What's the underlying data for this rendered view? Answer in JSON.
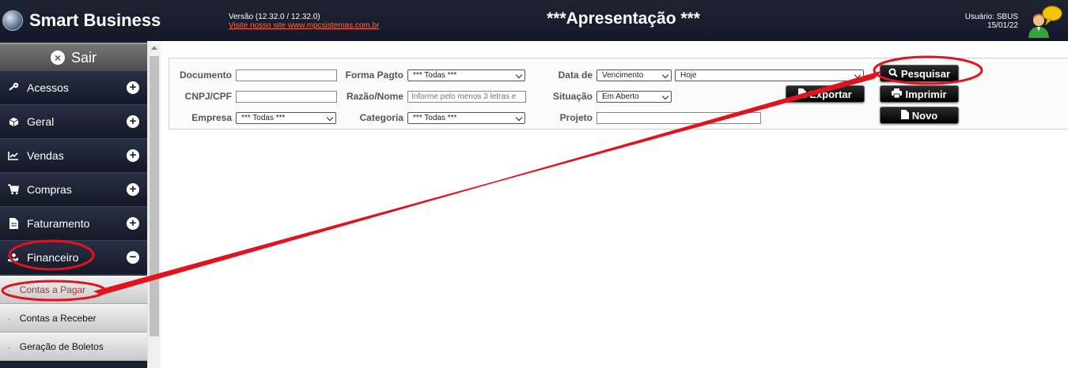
{
  "header": {
    "app_title": "Smart Business",
    "version": "Versão (12.32.0 / 12.32.0)",
    "site_link": "Visite nosso site www.mpcsistemas.com.br",
    "page_title": "***Apresentação ***",
    "user": "Usuário: SBUS",
    "date": "15/01/22"
  },
  "sidebar": {
    "sair": "Sair",
    "items": [
      {
        "label": "Acessos",
        "icon": "key-icon"
      },
      {
        "label": "Geral",
        "icon": "cube-icon"
      },
      {
        "label": "Vendas",
        "icon": "chart-line-icon"
      },
      {
        "label": "Compras",
        "icon": "cart-icon"
      },
      {
        "label": "Faturamento",
        "icon": "file-icon"
      },
      {
        "label": "Financeiro",
        "icon": "money-hand-icon"
      }
    ],
    "subitems": [
      "Contas a Pagar",
      "Contas a Receber",
      "Geração de Boletos"
    ]
  },
  "filters": {
    "documento_label": "Documento",
    "documento_value": "",
    "cnpj_label": "CNPJ/CPF",
    "cnpj_value": "",
    "empresa_label": "Empresa",
    "empresa_value": "*** Todas ***",
    "forma_pagto_label": "Forma Pagto",
    "forma_pagto_value": "*** Todas ***",
    "razao_label": "Razão/Nome",
    "razao_placeholder": "Informe pelo menos 3 letras e",
    "categoria_label": "Categoria",
    "categoria_value": "*** Todas ***",
    "data_de_label": "Data de",
    "data_tipo_value": "Vencimento",
    "data_periodo_value": "Hoje",
    "situacao_label": "Situação",
    "situacao_value": "Em Aberto",
    "projeto_label": "Projeto",
    "projeto_value": ""
  },
  "buttons": {
    "pesquisar": "Pesquisar",
    "imprimir": "Imprimir",
    "novo": "Novo",
    "exportar": "Exportar"
  },
  "colors": {
    "header_bg": "#14182a",
    "sidebar_bg": "#1a1f2e",
    "annotation": "#e0141e",
    "link": "#ff6b4a"
  }
}
